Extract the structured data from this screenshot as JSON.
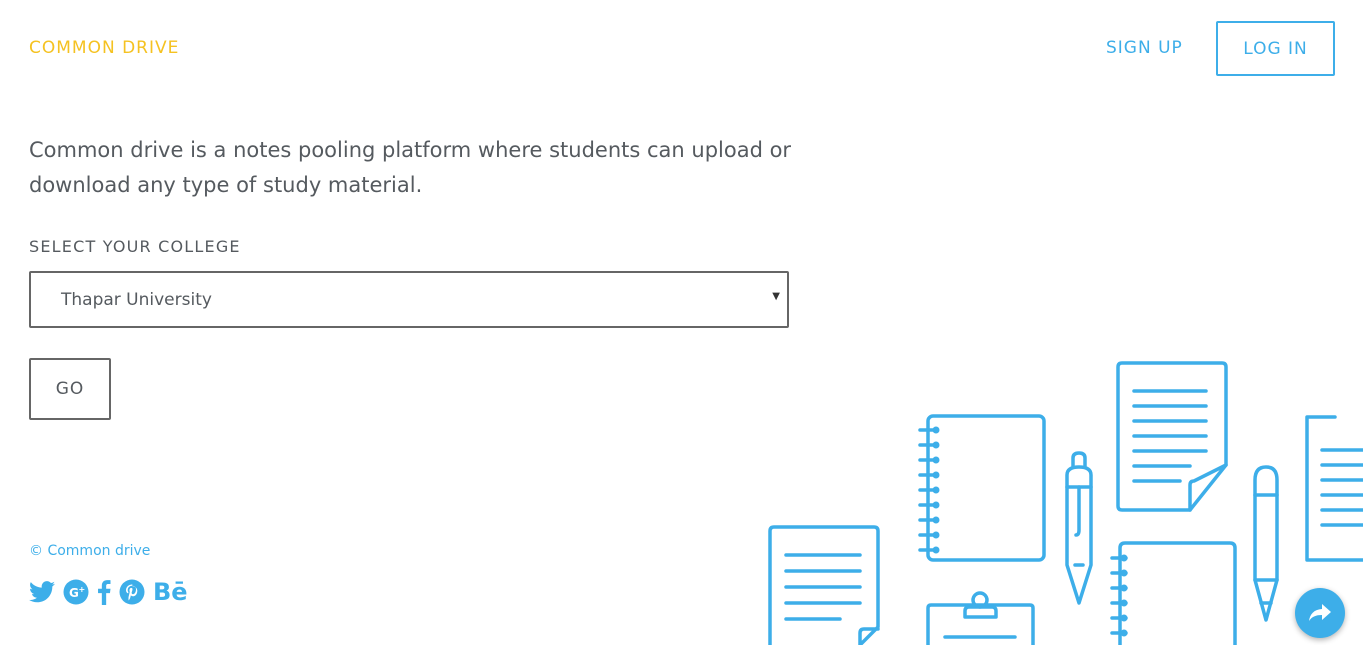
{
  "header": {
    "brand": "COMMON DRIVE",
    "signup_label": "SIGN UP",
    "login_label": "LOG IN"
  },
  "main": {
    "tagline": "Common drive is a notes pooling platform where students can upload or download any type of study material.",
    "select_label": "SELECT YOUR COLLEGE",
    "selected_college": "Thapar University",
    "go_label": "GO"
  },
  "footer": {
    "copyright": "© Common drive",
    "social_icons": [
      "twitter-icon",
      "google-plus-icon",
      "facebook-icon",
      "pinterest-icon",
      "behance-icon"
    ],
    "behance_text": "Bē"
  },
  "colors": {
    "brand": "#f5c221",
    "accent": "#3daee9",
    "text": "#555a5f"
  }
}
